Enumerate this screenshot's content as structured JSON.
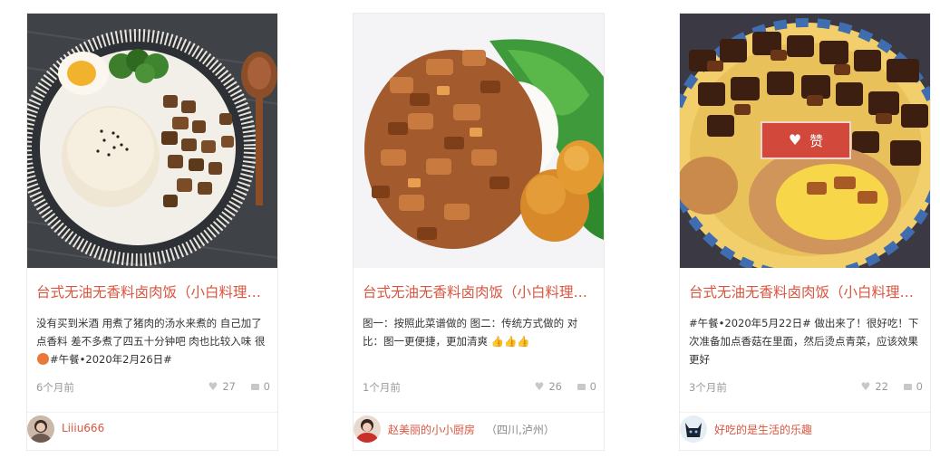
{
  "cards": [
    {
      "title": "台式无油无香料卤肉饭（小白料理…",
      "desc_before": "没有买到米酒 用煮了猪肉的汤水来煮的 自己加了点香料 差不多煮了四五十分钟吧 肉也比较入味 很",
      "desc_after": "#午餐•2020年2月26日#",
      "time": "6个月前",
      "likes": "27",
      "comments": "0",
      "author": "Liiiu666",
      "location": ""
    },
    {
      "title": "台式无油无香料卤肉饭（小白料理…",
      "desc": "图一：按照此菜谱做的 图二：传统方式做的 对比：图一更便捷，更加清爽",
      "thumbs": "👍👍👍",
      "time": "1个月前",
      "likes": "26",
      "comments": "0",
      "author": "赵美丽的小小厨房",
      "location": "（四川,泸州）"
    },
    {
      "title": "台式无油无香料卤肉饭（小白料理…",
      "desc": "#午餐•2020年5月22日# 做出来了！很好吃！下次准备加点香菇在里面，然后烫点青菜，应该效果更好",
      "time": "3个月前",
      "likes": "22",
      "comments": "0",
      "author": "好吃的是生活的乐趣",
      "location": ""
    }
  ],
  "like_button": {
    "label": "赞",
    "icon": "heart-icon"
  },
  "colors": {
    "title": "#d9553f",
    "like_bg": "#d2483a",
    "meta": "#9a9a9a"
  }
}
